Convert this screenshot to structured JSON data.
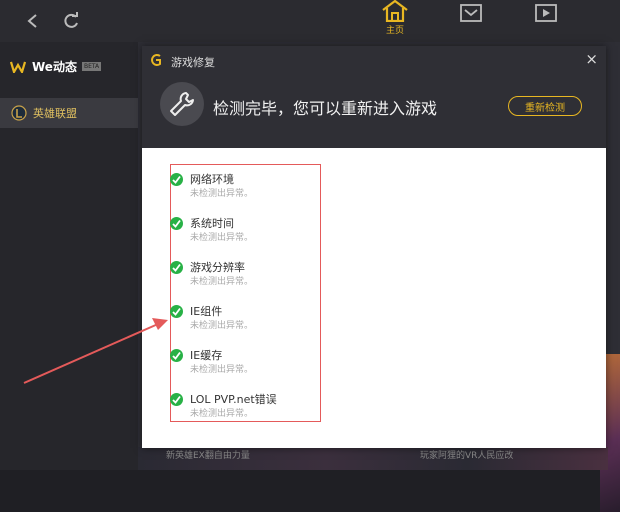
{
  "topbar": {
    "tabs": [
      {
        "label": "主页",
        "icon": "home-icon",
        "active": true
      },
      {
        "label": "",
        "icon": "inbox-icon",
        "active": false
      },
      {
        "label": "",
        "icon": "video-icon",
        "active": false
      }
    ]
  },
  "sidebar": {
    "brand": "We动态",
    "beta": "BETA",
    "items": [
      {
        "label": "英雄联盟",
        "icon": "league-of-legends-icon"
      }
    ]
  },
  "background": {
    "captions": [
      "新英雄EX翻自由力量",
      "玩家阿狸的VR人民应改"
    ]
  },
  "dialog": {
    "title": "游戏修复",
    "close": "×",
    "headline": "检测完毕，您可以重新进入游戏",
    "redetect_label": "重新检测",
    "items": [
      {
        "name": "网络环境",
        "status": "未检测出异常。"
      },
      {
        "name": "系统时间",
        "status": "未检测出异常。"
      },
      {
        "name": "游戏分辨率",
        "status": "未检测出异常。"
      },
      {
        "name": "IE组件",
        "status": "未检测出异常。"
      },
      {
        "name": "IE缓存",
        "status": "未检测出异常。"
      },
      {
        "name": "LOL PVP.net错误",
        "status": "未检测出异常。"
      }
    ]
  },
  "colors": {
    "accent": "#e8b722",
    "success": "#28b146",
    "annotation": "#e45a5a"
  }
}
